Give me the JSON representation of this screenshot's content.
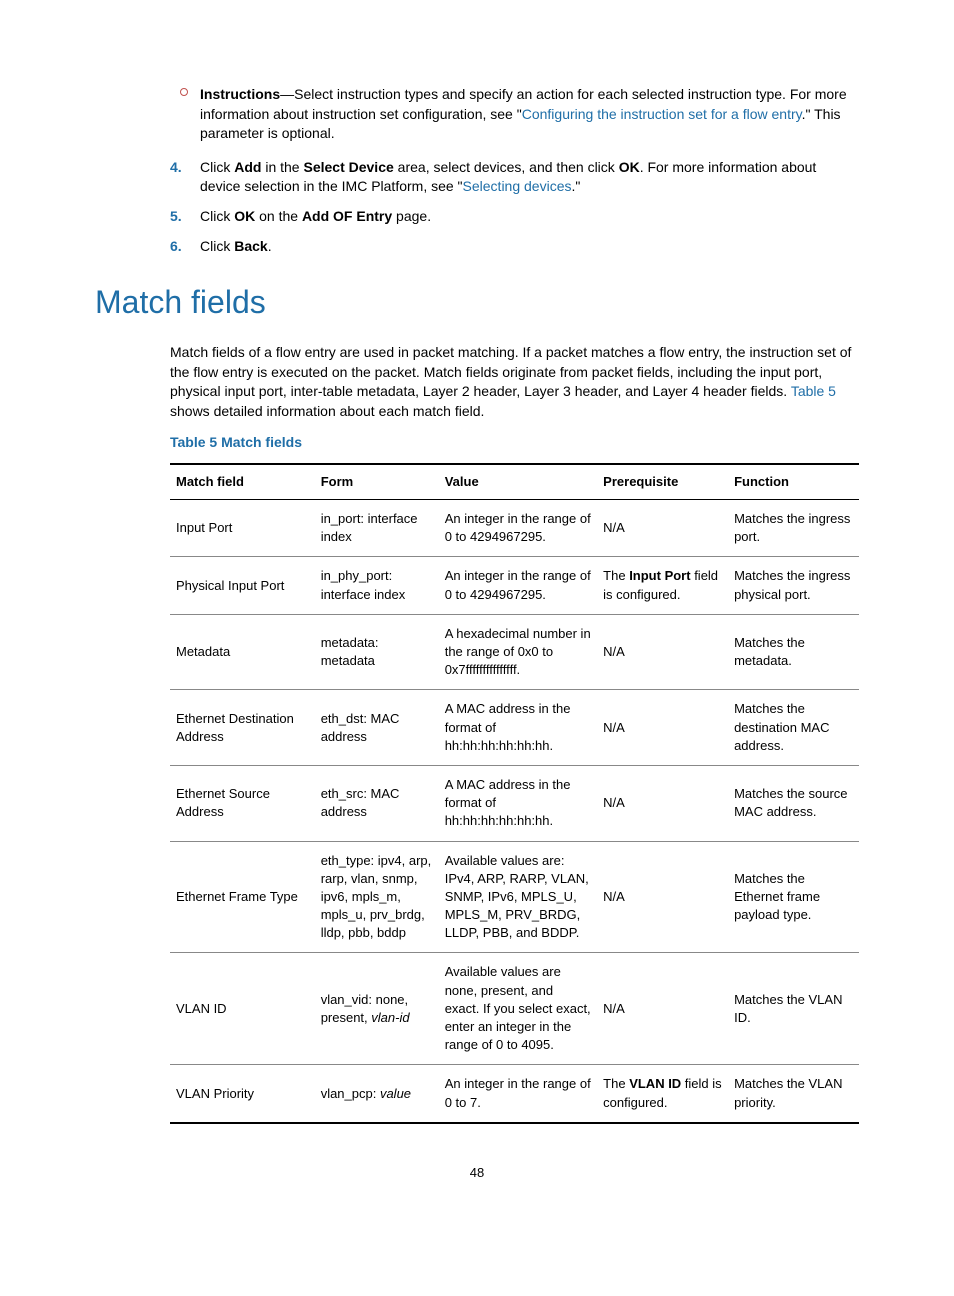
{
  "bullet": {
    "label": "Instructions",
    "text1": "—Select instruction types and specify an action for each selected instruction type. For more information about instruction set configuration, see \"",
    "link": "Configuring the instruction set for a flow entry",
    "text2": ".\" This parameter is optional."
  },
  "steps": {
    "s4": {
      "n": "4.",
      "t1": "Click ",
      "b1": "Add",
      "t2": " in the ",
      "b2": "Select Device",
      "t3": " area, select devices, and then click ",
      "b3": "OK",
      "t4": ". For more information about device selection in the IMC Platform, see \"",
      "link": "Selecting devices",
      "t5": ".\""
    },
    "s5": {
      "n": "5.",
      "t1": "Click ",
      "b1": "OK",
      "t2": " on the ",
      "b2": "Add OF Entry",
      "t3": " page."
    },
    "s6": {
      "n": "6.",
      "t1": "Click ",
      "b1": "Back",
      "t2": "."
    }
  },
  "heading": "Match fields",
  "para": {
    "t1": "Match fields of a flow entry are used in packet matching. If a packet matches a flow entry, the instruction set of the flow entry is executed on the packet. Match fields originate from packet fields, including the input port, physical input port, inter-table metadata, Layer 2 header, Layer 3 header, and Layer 4 header fields. ",
    "link": "Table 5",
    "t2": " shows detailed information about each match field."
  },
  "caption": "Table 5 Match fields",
  "headers": {
    "c1": "Match field",
    "c2": "Form",
    "c3": "Value",
    "c4": "Prerequisite",
    "c5": "Function"
  },
  "rows": [
    {
      "c1": "Input Port",
      "c2": "in_port: interface index",
      "c3": "An integer in the range of 0 to 4294967295.",
      "c4": "N/A",
      "c5": "Matches the ingress port."
    },
    {
      "c1": "Physical Input Port",
      "c2": "in_phy_port: interface index",
      "c3": "An integer in the range of 0 to 4294967295.",
      "c4_pre": "The ",
      "c4_b": "Input Port",
      "c4_post": " field is configured.",
      "c5": "Matches the ingress physical port."
    },
    {
      "c1": "Metadata",
      "c2": "metadata: metadata",
      "c3": "A hexadecimal number in the range of 0x0 to 0x7fffffffffffffff.",
      "c4": "N/A",
      "c5": "Matches the metadata."
    },
    {
      "c1": "Ethernet Destination Address",
      "c2": "eth_dst: MAC address",
      "c3": "A MAC address in the format of hh:hh:hh:hh:hh:hh.",
      "c4": "N/A",
      "c5": "Matches the destination MAC address."
    },
    {
      "c1": "Ethernet Source Address",
      "c2": "eth_src: MAC address",
      "c3": "A MAC address in the format of hh:hh:hh:hh:hh:hh.",
      "c4": "N/A",
      "c5": "Matches the source MAC address."
    },
    {
      "c1": "Ethernet Frame Type",
      "c2": "eth_type: ipv4, arp, rarp, vlan, snmp, ipv6, mpls_m, mpls_u, prv_brdg, lldp, pbb, bddp",
      "c3": "Available values are: IPv4, ARP, RARP, VLAN, SNMP, IPv6, MPLS_U, MPLS_M, PRV_BRDG, LLDP, PBB, and BDDP.",
      "c4": "N/A",
      "c5": "Matches the Ethernet frame payload type."
    },
    {
      "c1": "VLAN ID",
      "c2_pre": "vlan_vid: none, present, ",
      "c2_i": "vlan-id",
      "c3": "Available values are none, present, and exact. If you select exact, enter an integer in the range of 0 to 4095.",
      "c4": "N/A",
      "c5": "Matches the VLAN ID."
    },
    {
      "c1": "VLAN Priority",
      "c2_pre": "vlan_pcp: ",
      "c2_i": "value",
      "c3": "An integer in the range of 0 to 7.",
      "c4_pre": "The ",
      "c4_b": "VLAN ID",
      "c4_post": " field is configured.",
      "c5": "Matches the VLAN priority."
    }
  ],
  "pagenum": "48"
}
